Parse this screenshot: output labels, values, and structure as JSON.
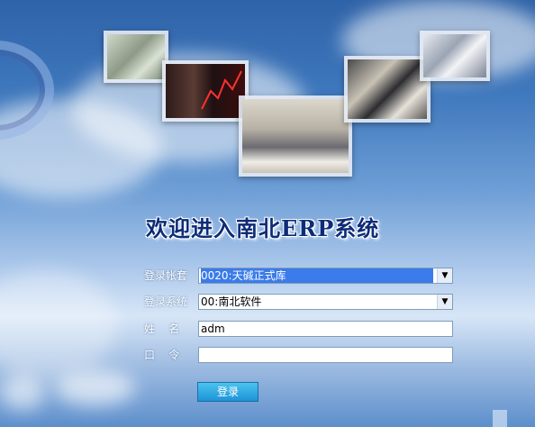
{
  "title": "欢迎进入南北ERP系统",
  "form": {
    "account_label": "登录帐套",
    "account_value": "0020:天碱正式库",
    "system_label": "登录系统",
    "system_value": "00:南北软件",
    "name_label": "姓    名",
    "name_value": "adm",
    "password_label": "口    令",
    "password_value": ""
  },
  "login_button": "登录"
}
